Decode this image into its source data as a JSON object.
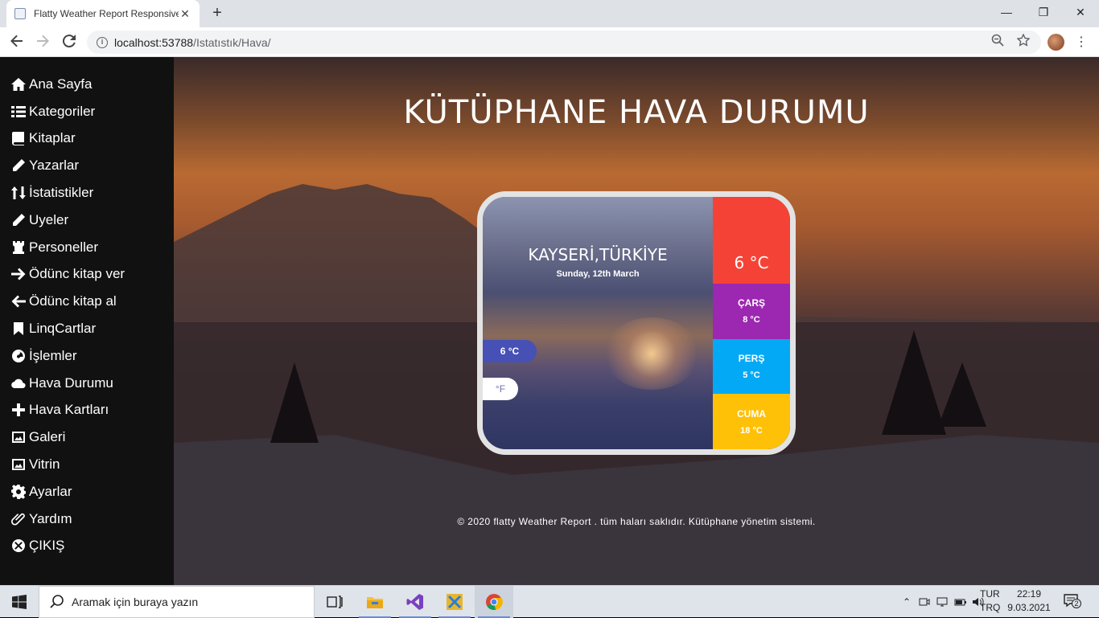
{
  "browser": {
    "tab_title": "Flatty Weather Report Responsive",
    "tab_close": "✕",
    "new_tab": "+",
    "url_host": "localhost:53788",
    "url_path": "/Istatıstık/Hava/",
    "window_controls": {
      "minimize": "—",
      "maximize": "❐",
      "close": "✕"
    }
  },
  "sidebar": {
    "items": [
      {
        "label": "Ana Sayfa",
        "icon": "home-icon"
      },
      {
        "label": "Kategoriler",
        "icon": "list-icon"
      },
      {
        "label": "Kitaplar",
        "icon": "book-icon"
      },
      {
        "label": "Yazarlar",
        "icon": "pencil-icon"
      },
      {
        "label": "İstatistikler",
        "icon": "sort-icon"
      },
      {
        "label": "Uyeler",
        "icon": "pencil-icon"
      },
      {
        "label": "Personeller",
        "icon": "chess-rook-icon"
      },
      {
        "label": "Ödünc kitap ver",
        "icon": "arrow-right-icon"
      },
      {
        "label": "Ödünc kitap al",
        "icon": "arrow-left-icon"
      },
      {
        "label": "LinqCartlar",
        "icon": "bookmark-icon"
      },
      {
        "label": "İşlemler",
        "icon": "dashboard-icon"
      },
      {
        "label": "Hava Durumu",
        "icon": "cloud-icon"
      },
      {
        "label": "Hava Kartları",
        "icon": "plus-icon"
      },
      {
        "label": "Galeri",
        "icon": "image-icon"
      },
      {
        "label": "Vitrin",
        "icon": "image-icon"
      },
      {
        "label": "Ayarlar",
        "icon": "gear-icon"
      },
      {
        "label": "Yardım",
        "icon": "paperclip-icon"
      },
      {
        "label": "ÇIKIŞ",
        "icon": "close-circle-icon"
      }
    ]
  },
  "main": {
    "title": "KÜTÜPHANE HAVA DURUMU",
    "weather": {
      "city": "KAYSERİ,TÜRKİYE",
      "date": "Sunday, 12th March",
      "current_temp": "6 °C",
      "unit_celsius": "6 °C",
      "unit_fahrenheit": "°F",
      "forecast": [
        {
          "day": "ÇARŞ",
          "temp": "8 °C",
          "color": "#9c27b0"
        },
        {
          "day": "PERŞ",
          "temp": "5 °C",
          "color": "#03a9f4"
        },
        {
          "day": "CUMA",
          "temp": "18 °C",
          "color": "#ffc107"
        }
      ],
      "today_color": "#f44336"
    },
    "footer": "© 2020 flatty Weather Report . tüm haları saklıdır. Kütüphane yönetim sistemi."
  },
  "taskbar": {
    "search_placeholder": "Aramak için buraya yazın",
    "lang_top": "TUR",
    "lang_bottom": "TRQ",
    "time": "22:19",
    "date": "9.03.2021",
    "notification_count": "2"
  }
}
